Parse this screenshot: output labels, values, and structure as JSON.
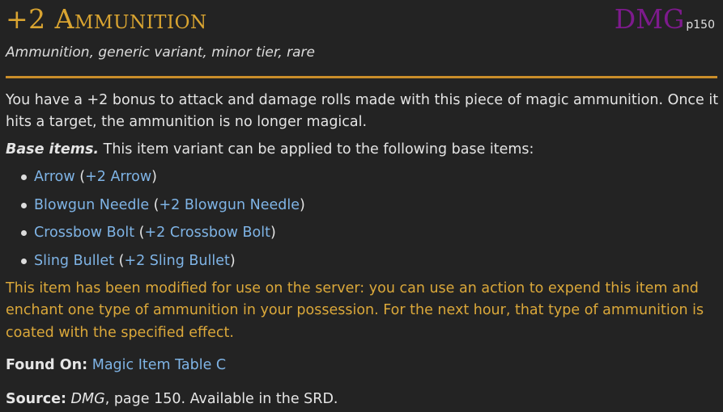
{
  "item": {
    "title": "+2 Ammunition",
    "source_abbr": "DMG",
    "source_page": "p150",
    "subtitle": "Ammunition, generic variant, minor tier, rare"
  },
  "colors": {
    "background": "#232323",
    "title": "#d9a431",
    "source_abbr": "#7d1a8c",
    "divider": "#c98d2a",
    "link": "#7fb4e6",
    "server_note": "#dba83a",
    "text": "#e4e4e4"
  },
  "description": {
    "paragraph1": "You have a +2 bonus to attack and damage rolls made with this piece of magic ammunition. Once it hits a target, the ammunition is no longer magical.",
    "base_items_label": "Base items.",
    "base_items_text": " This item variant can be applied to the following base items:"
  },
  "base_items": [
    {
      "base": "Arrow",
      "variant": "+2 Arrow"
    },
    {
      "base": "Blowgun Needle",
      "variant": "+2 Blowgun Needle"
    },
    {
      "base": "Crossbow Bolt",
      "variant": "+2 Crossbow Bolt"
    },
    {
      "base": "Sling Bullet",
      "variant": "+2 Sling Bullet"
    }
  ],
  "server_note": "This item has been modified for use on the server: you can use an action to expend this item and enchant one type of ammunition in your possession. For the next hour, that type of ammunition is coated with the specified effect.",
  "found_on": {
    "label": "Found On:",
    "value": "Magic Item Table C"
  },
  "source": {
    "label": "Source:",
    "book": "DMG",
    "rest": ", page 150. Available in the SRD."
  }
}
